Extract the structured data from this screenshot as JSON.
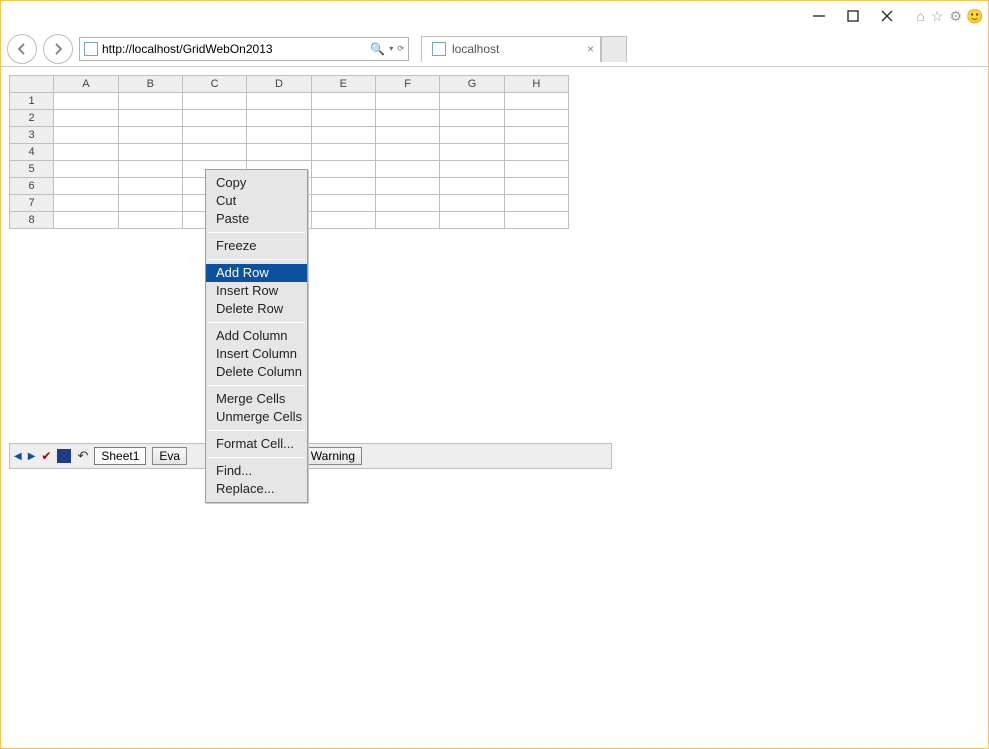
{
  "window": {
    "minimize_title": "Minimize",
    "maximize_title": "Maximize",
    "close_title": "Close"
  },
  "nav": {
    "url": "http://localhost/GridWebOn2013",
    "tab_title": "localhost"
  },
  "sheet": {
    "columns": [
      "A",
      "B",
      "C",
      "D",
      "E",
      "F",
      "G",
      "H"
    ],
    "rows": [
      "1",
      "2",
      "3",
      "4",
      "5",
      "6",
      "7",
      "8"
    ],
    "selected_cell": {
      "row": "6",
      "col": "C"
    }
  },
  "gridbar": {
    "sheet_name": "Sheet1",
    "button_a_prefix": "Eva",
    "button_b_visible": "t Warning"
  },
  "ctx": {
    "groups": [
      [
        "Copy",
        "Cut",
        "Paste"
      ],
      [
        "Freeze"
      ],
      [
        "Add Row",
        "Insert Row",
        "Delete Row"
      ],
      [
        "Add Column",
        "Insert Column",
        "Delete Column"
      ],
      [
        "Merge Cells",
        "Unmerge Cells"
      ],
      [
        "Format Cell..."
      ],
      [
        "Find...",
        "Replace..."
      ]
    ],
    "highlighted": "Add Row"
  }
}
